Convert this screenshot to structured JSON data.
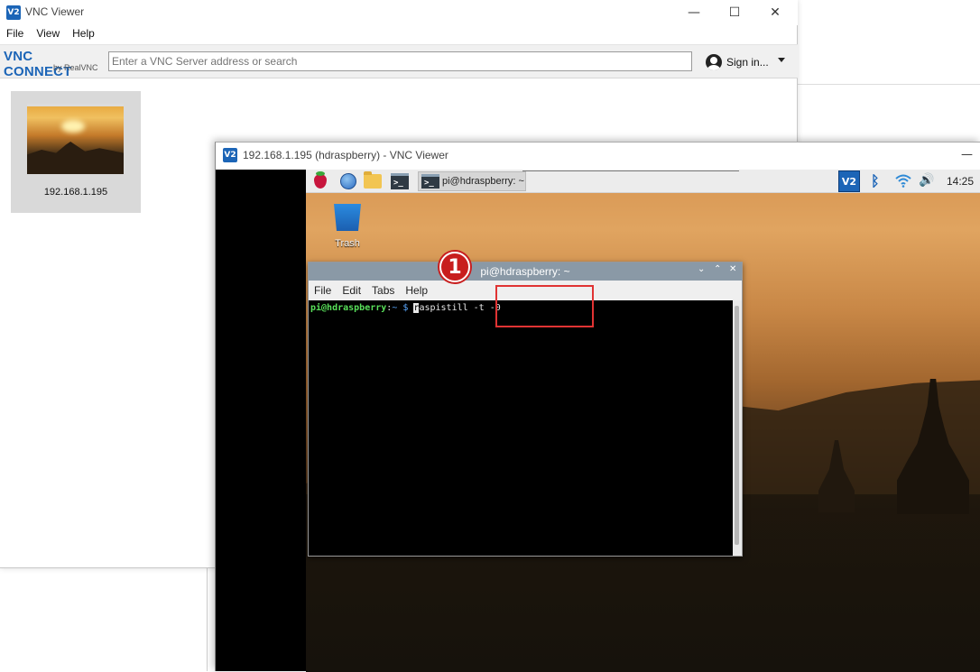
{
  "main_window": {
    "title": "VNC Viewer",
    "logo_text": "V2",
    "menu": [
      "File",
      "View",
      "Help"
    ],
    "brand_main": "VNC CONNECT",
    "brand_sub": "by RealVNC",
    "search_placeholder": "Enter a VNC Server address or search",
    "signin_label": "Sign in...",
    "address_card": {
      "label": "192.168.1.195"
    },
    "controls": {
      "minimize": "—",
      "maximize": "☐",
      "close": "✕"
    }
  },
  "session_window": {
    "title": "192.168.1.195 (hdraspberry) - VNC Viewer",
    "logo_text": "V2",
    "minimize": "—",
    "panel": {
      "task_label": "pi@hdraspberry: ~",
      "term_icon_text": ">_",
      "tray_vnc_text": "V2",
      "bluetooth": "ᛒ",
      "volume": "🔊",
      "time": "14:25"
    },
    "desktop": {
      "trash_label": "Trash"
    },
    "terminal": {
      "title": "pi@hdraspberry: ~",
      "controls": {
        "minimize": "⌄",
        "maximize": "⌃",
        "close": "✕"
      },
      "menu": [
        "File",
        "Edit",
        "Tabs",
        "Help"
      ],
      "prompt_user": "pi@hdraspberry",
      "prompt_sep": ":",
      "prompt_path": "~ $",
      "command_first": "r",
      "command_rest": "aspistill -t -0"
    }
  },
  "annotation": {
    "badge": "1",
    "color": "#e03333"
  }
}
